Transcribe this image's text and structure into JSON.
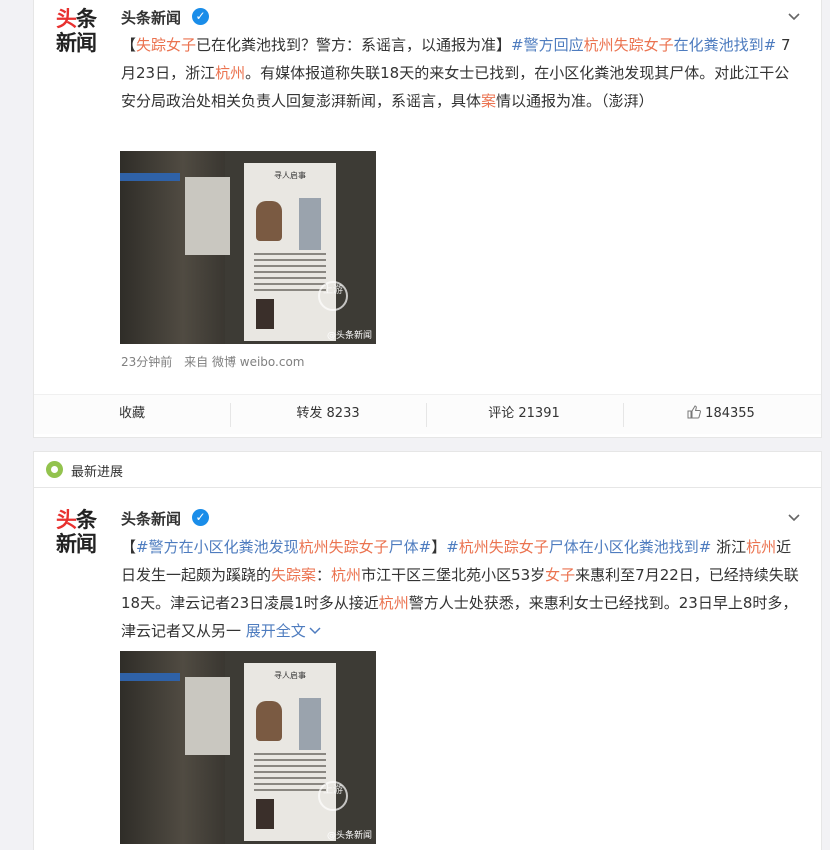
{
  "post1": {
    "author": "头条新闻",
    "avatar_line1_a": "头",
    "avatar_line1_b": "条",
    "avatar_line2": "新闻",
    "text_parts": [
      {
        "t": "【",
        "c": "plain"
      },
      {
        "t": "失踪女子",
        "c": "link"
      },
      {
        "t": "已在化粪池找到？警方：系谣言，以通报为准】",
        "c": "plain"
      },
      {
        "t": "#警方回应",
        "c": "tag"
      },
      {
        "t": "杭州失踪女子",
        "c": "link"
      },
      {
        "t": "在化粪池找到#",
        "c": "tag"
      },
      {
        "t": " 7月23日，浙江",
        "c": "plain"
      },
      {
        "t": "杭州",
        "c": "link"
      },
      {
        "t": "。有媒体报道称失联18天的来女士已找到，在小区化粪池发现其尸体。对此江干公安分局政治处相关负责人回复澎湃新闻，系谣言，具体",
        "c": "plain"
      },
      {
        "t": "案",
        "c": "link"
      },
      {
        "t": "情以通报为准。（澎湃）",
        "c": "plain"
      }
    ],
    "photo_title": "寻人启事",
    "photo_seal": "上游",
    "photo_watermark": "@头条新闻",
    "time": "23分钟前",
    "source_prefix": "来自",
    "source": "微博 weibo.com",
    "actions": {
      "favorite": "收藏",
      "repost": "转发 8233",
      "comment": "评论 21391",
      "like": "184355"
    }
  },
  "progress_label": "最新进展",
  "post2": {
    "author": "头条新闻",
    "avatar_line1_a": "头",
    "avatar_line1_b": "条",
    "avatar_line2": "新闻",
    "text_parts": [
      {
        "t": "【",
        "c": "plain"
      },
      {
        "t": "#警方在小区化粪池发现",
        "c": "tag"
      },
      {
        "t": "杭州失踪女子",
        "c": "link"
      },
      {
        "t": "尸体#",
        "c": "tag"
      },
      {
        "t": "】",
        "c": "plain"
      },
      {
        "t": "#",
        "c": "tag"
      },
      {
        "t": "杭州失踪女子",
        "c": "link"
      },
      {
        "t": "尸体在小区化粪池找到#",
        "c": "tag"
      },
      {
        "t": " 浙江",
        "c": "plain"
      },
      {
        "t": "杭州",
        "c": "link"
      },
      {
        "t": "近日发生一起颇为蹊跷的",
        "c": "plain"
      },
      {
        "t": "失踪案",
        "c": "link"
      },
      {
        "t": "：",
        "c": "plain"
      },
      {
        "t": "杭州",
        "c": "link"
      },
      {
        "t": "市江干区三堡北苑小区53岁",
        "c": "plain"
      },
      {
        "t": "女子",
        "c": "link"
      },
      {
        "t": "来惠利至7月22日，已经持续失联18天。津云记者23日凌晨1时多从接近",
        "c": "plain"
      },
      {
        "t": "杭州",
        "c": "link"
      },
      {
        "t": "警方人士处获悉，来惠利女士已经找到。23日早上8时多，津云记者又从另一 ",
        "c": "plain"
      }
    ],
    "expand_label": "展开全文",
    "photo_title": "寻人启事",
    "photo_seal": "上游",
    "photo_watermark": "@头条新闻"
  },
  "colors": {
    "link": "#eb7350",
    "tag": "#4e7cbf",
    "verified": "#1a8de9",
    "progress_pin": "#93c34e"
  },
  "icons": [
    "verified-icon",
    "chevron-down-icon",
    "thumb-up-icon",
    "progress-pin-icon"
  ]
}
